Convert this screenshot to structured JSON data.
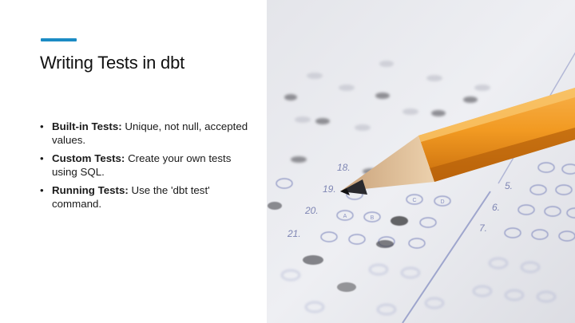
{
  "slide": {
    "title": "Writing Tests in dbt",
    "accent_color": "#1b8bc4",
    "bullets": [
      {
        "bold": "Built-in Tests:",
        "text": " Unique, not null, accepted values."
      },
      {
        "bold": "Custom Tests:",
        "text": " Create your own tests using SQL."
      },
      {
        "bold": "Running Tests:",
        "text": " Use the 'dbt test' command."
      }
    ]
  },
  "photo": {
    "description_icon": "answer-sheet-with-pencil-photo",
    "row_numbers_left": [
      "18.",
      "19.",
      "20.",
      "21."
    ],
    "row_numbers_right": [
      "5.",
      "6.",
      "7."
    ],
    "bubble_letters": [
      "A",
      "B",
      "C",
      "D"
    ]
  }
}
